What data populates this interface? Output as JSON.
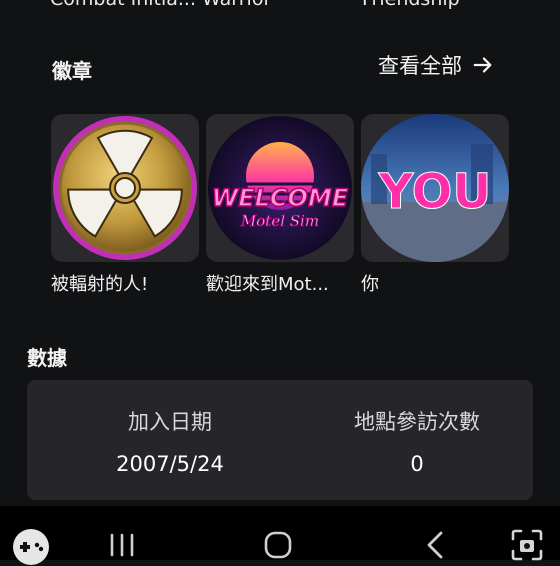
{
  "top_row": [
    "Combat Initia... Warrior",
    "",
    "Friendship"
  ],
  "badges": {
    "title": "徽章",
    "see_all": "查看全部",
    "items": [
      {
        "name": "被輻射的人!",
        "icon": "radiation-badge-icon"
      },
      {
        "name": "歡迎來到Mot...",
        "icon": "welcome-motel-sim-badge-icon",
        "art_text_1": "WELCOME",
        "art_text_2": "Motel Sim"
      },
      {
        "name": "你",
        "icon": "you-badge-icon",
        "art_text": "YOU"
      }
    ]
  },
  "stats": {
    "title": "數據",
    "items": [
      {
        "label": "加入日期",
        "value": "2007/5/24"
      },
      {
        "label": "地點參訪次數",
        "value": "0"
      }
    ]
  },
  "navbar": {
    "buttons": [
      "gamepad-icon",
      "recent-apps-icon",
      "home-icon",
      "back-icon",
      "screenshot-icon"
    ]
  },
  "colors": {
    "background": "#111214",
    "card": "#25252a",
    "badge_card": "#2a2a2e",
    "accent_pink": "#ff2fa8",
    "gold": "#c8a048"
  }
}
